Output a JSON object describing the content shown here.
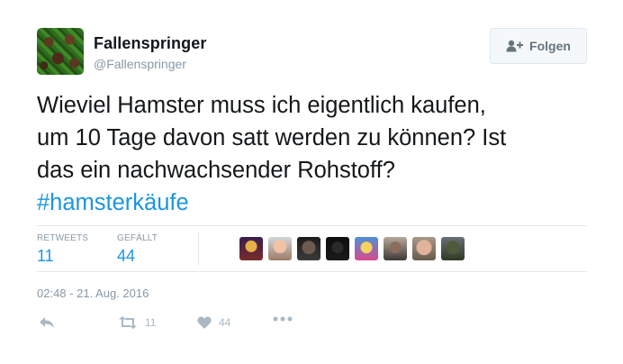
{
  "user": {
    "name": "Fallenspringer",
    "handle": "@Fallenspringer"
  },
  "follow_button": {
    "label": "Folgen",
    "icon": "follow-person-plus-icon"
  },
  "tweet": {
    "lines": [
      "Wieviel Hamster muss ich eigentlich kaufen,",
      "um 10 Tage davon satt werden zu können? Ist",
      "das ein nachwachsender Rohstoff?"
    ],
    "hashtag": "#hamsterkäufe"
  },
  "stats": {
    "retweets_label": "RETWEETS",
    "retweets_count": "11",
    "likes_label": "GEFÄLLT",
    "likes_count": "44"
  },
  "timestamp": "02:48 - 21. Aug. 2016",
  "actions": {
    "retweet_count": "11",
    "like_count": "44"
  },
  "colors": {
    "link": "#1b95e0",
    "muted": "#8899a6",
    "icon": "#aab8c2",
    "border": "#e1e8ed"
  }
}
